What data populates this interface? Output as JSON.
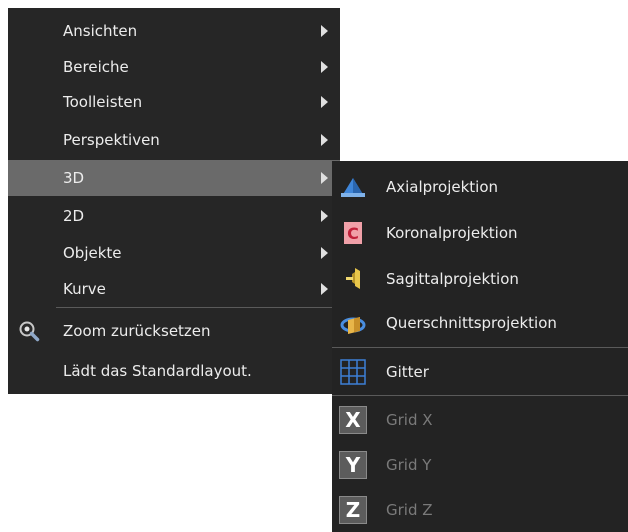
{
  "main_menu": {
    "items": [
      {
        "label": "Ansichten"
      },
      {
        "label": "Bereiche"
      },
      {
        "label": "Toolleisten"
      },
      {
        "label": "Perspektiven"
      },
      {
        "label": "3D"
      },
      {
        "label": "2D"
      },
      {
        "label": "Objekte"
      },
      {
        "label": "Kurve"
      }
    ],
    "zoom_reset_label": "Zoom zurücksetzen",
    "default_layout_label": "Lädt das Standardlayout."
  },
  "submenu_3d": {
    "axial_label": "Axialprojektion",
    "coronal_label": "Koronalprojektion",
    "coronal_icon_letter": "C",
    "sagittal_label": "Sagittalprojektion",
    "cross_section_label": "Querschnittsprojektion",
    "grid_label": "Gitter",
    "grid_x_label": "Grid X",
    "grid_x_letter": "X",
    "grid_y_label": "Grid Y",
    "grid_y_letter": "Y",
    "grid_z_label": "Grid Z",
    "grid_z_letter": "Z"
  },
  "colors": {
    "menu_background": "#262626",
    "hover_background": "#6a6a6a",
    "text": "#ececec",
    "disabled_text": "#7a7a7a",
    "grid_icon": "#3d7fd6"
  }
}
